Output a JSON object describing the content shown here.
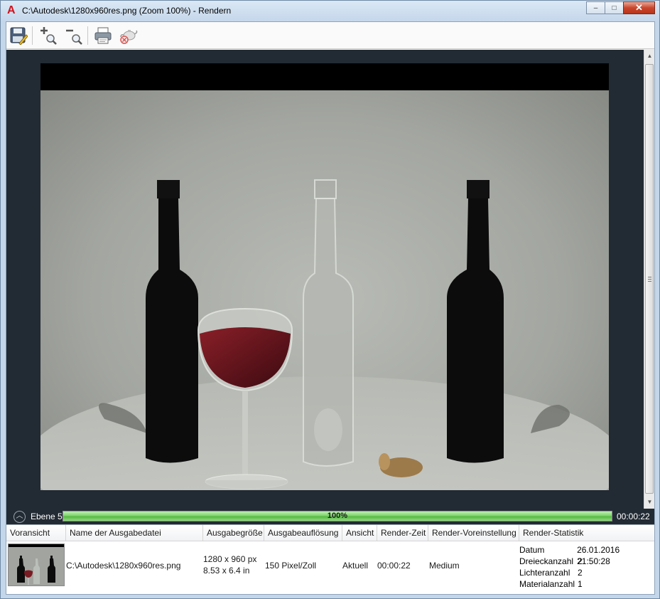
{
  "window": {
    "title": "C:\\Autodesk\\1280x960res.png (Zoom 100%) - Rendern",
    "buttons": {
      "minimize": "–",
      "maximize": "□",
      "close": "✕"
    }
  },
  "toolbar": {
    "items": [
      {
        "name": "save-icon",
        "icon": "floppy-disk-pencil"
      },
      {
        "name": "zoom-in-icon",
        "icon": "magnifier-plus"
      },
      {
        "name": "zoom-out-icon",
        "icon": "magnifier-minus"
      },
      {
        "name": "print-icon",
        "icon": "printer"
      },
      {
        "name": "cancel-render-icon",
        "icon": "teapot-cancel"
      }
    ]
  },
  "status": {
    "collapse_icon": "chevron-up",
    "level": "Ebene 5",
    "progress_text": "100%",
    "progress_fraction": 1.0,
    "elapsed": "00:00:22"
  },
  "history": {
    "columns": [
      "Voransicht",
      "Name der Ausgabedatei",
      "Ausgabegröße",
      "Ausgabeauflösung",
      "Ansicht",
      "Render-Zeit",
      "Render-Voreinstellung",
      "Render-Statistik"
    ],
    "row": {
      "filename": "C:\\Autodesk\\1280x960res.png",
      "size_px": "1280 x 960 px",
      "size_in": "8.53 x 6.4 in",
      "resolution": "150 Pixel/Zoll",
      "view": "Aktuell",
      "render_time": "00:00:22",
      "preset": "Medium",
      "stats": [
        {
          "key": "Datum",
          "value": "26.01.2016 21:50:28"
        },
        {
          "key": "Dreieckanzahl",
          "value": "2"
        },
        {
          "key": "Lichteranzahl",
          "value": "2"
        },
        {
          "key": "Materialanzahl",
          "value": "1"
        }
      ]
    }
  },
  "colors": {
    "viewport_bg": "#222a33",
    "progress_green": "#56b843",
    "logo_red": "#d0111d"
  }
}
